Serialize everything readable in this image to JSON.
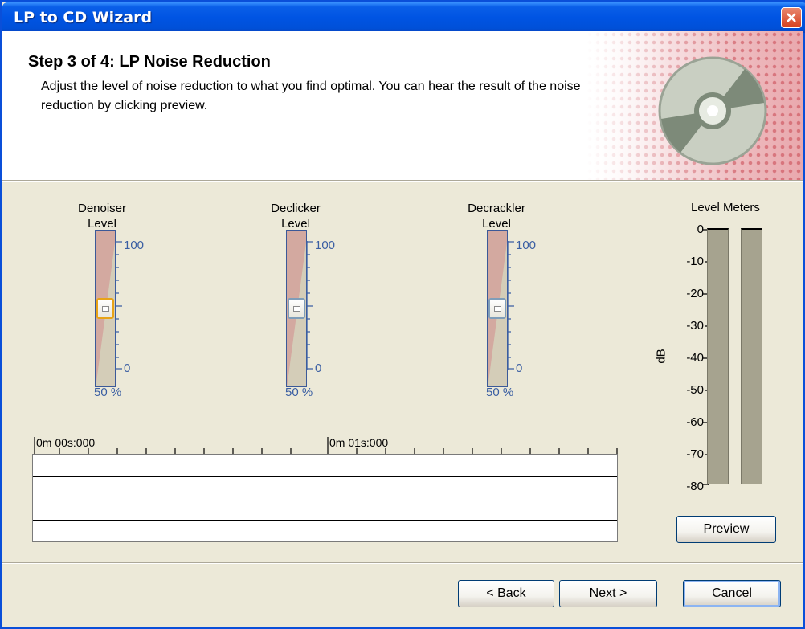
{
  "window": {
    "title": "LP to CD Wizard"
  },
  "header": {
    "step_title": "Step 3 of 4: LP Noise Reduction",
    "description": "Adjust the level of noise reduction to what you find optimal. You can hear the result of the noise reduction by clicking preview."
  },
  "sliders": [
    {
      "label_line1": "Denoiser",
      "label_line2": "Level",
      "max": "100",
      "min": "0",
      "value_text": "50 %",
      "value": 0.5
    },
    {
      "label_line1": "Declicker",
      "label_line2": "Level",
      "max": "100",
      "min": "0",
      "value_text": "50 %",
      "value": 0.5
    },
    {
      "label_line1": "Decrackler",
      "label_line2": "Level",
      "max": "100",
      "min": "0",
      "value_text": "50 %",
      "value": 0.5
    }
  ],
  "timeline": {
    "start_label": "0m 00s:000",
    "mid_label": "0m 01s:000"
  },
  "level_meters": {
    "title": "Level Meters",
    "unit": "dB",
    "scale": [
      "0",
      "-10",
      "-20",
      "-30",
      "-40",
      "-50",
      "-60",
      "-70",
      "-80"
    ]
  },
  "buttons": {
    "preview": "Preview",
    "back": "< Back",
    "next": "Next >",
    "cancel": "Cancel"
  },
  "colors": {
    "titlebar": "#0054e3",
    "accent": "#3b5fa3",
    "background": "#ece9d8"
  }
}
